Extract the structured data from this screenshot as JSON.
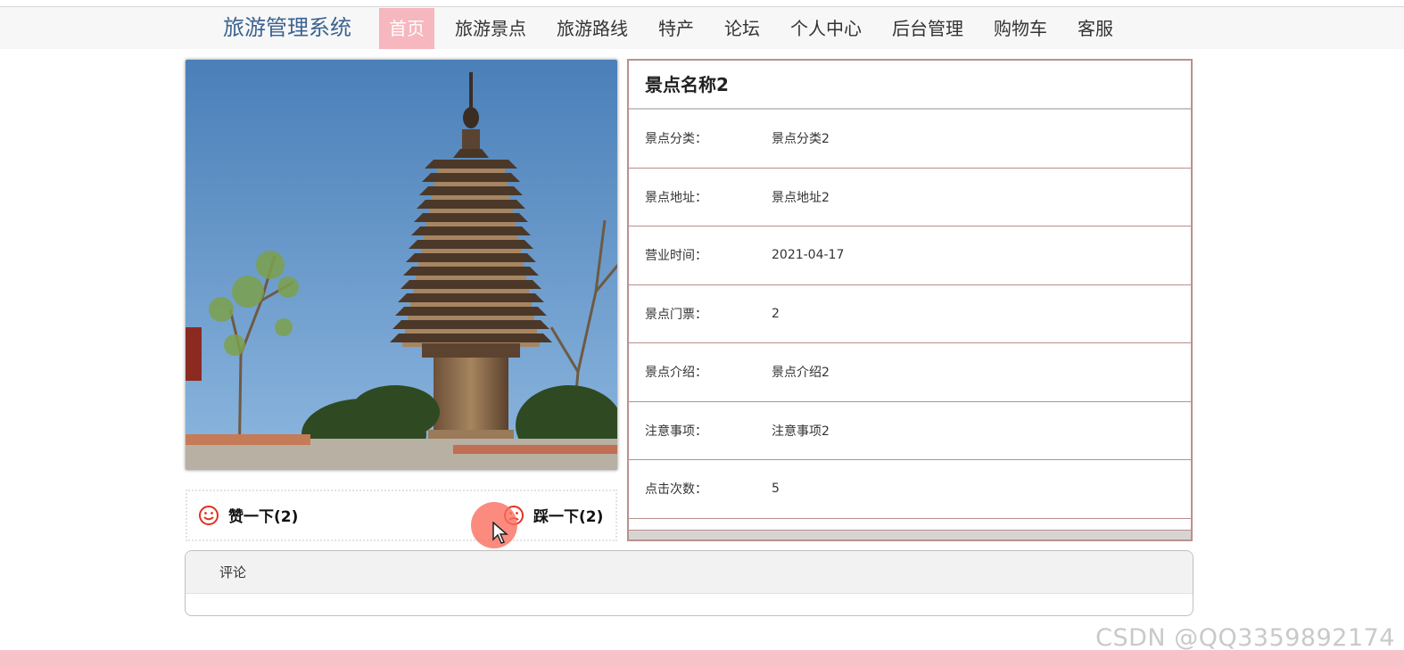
{
  "brand": "旅游管理系统",
  "nav": [
    {
      "label": "首页",
      "active": true
    },
    {
      "label": "旅游景点"
    },
    {
      "label": "旅游路线"
    },
    {
      "label": "特产"
    },
    {
      "label": "论坛"
    },
    {
      "label": "个人中心"
    },
    {
      "label": "后台管理"
    },
    {
      "label": "购物车"
    },
    {
      "label": "客服"
    }
  ],
  "detail": {
    "title": "景点名称2",
    "rows": [
      {
        "label": "景点分类：",
        "value": "景点分类2"
      },
      {
        "label": "景点地址：",
        "value": "景点地址2"
      },
      {
        "label": "营业时间：",
        "value": "2021-04-17"
      },
      {
        "label": "景点门票：",
        "value": "2"
      },
      {
        "label": "景点介绍：",
        "value": "景点介绍2"
      },
      {
        "label": "注意事项：",
        "value": "注意事项2"
      },
      {
        "label": "点击次数：",
        "value": "5"
      }
    ]
  },
  "votes": {
    "like": "赞一下(2)",
    "dislike": "踩一下(2)"
  },
  "comment": {
    "header": "评论"
  },
  "watermark": "CSDN @QQ3359892174",
  "colors": {
    "brand": "#3b6390",
    "active_nav": "#f6b7bf",
    "border": "#b9918f",
    "footer": "#f7c3c9",
    "vote_icon": "#e0321e"
  },
  "icons": {
    "like": "smile-icon",
    "dislike": "frown-icon"
  }
}
